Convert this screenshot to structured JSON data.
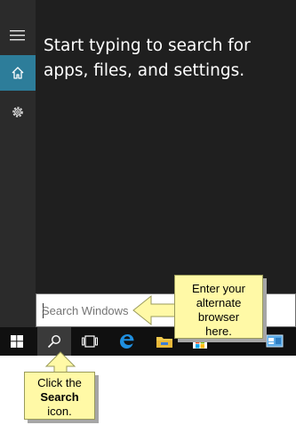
{
  "start_panel": {
    "prompt": "Start typing to search for apps, files, and settings."
  },
  "sidebar": {
    "items": [
      {
        "name": "menu",
        "icon": "hamburger-menu-icon"
      },
      {
        "name": "home",
        "icon": "home-icon",
        "active": true
      },
      {
        "name": "settings",
        "icon": "gear-icon"
      }
    ]
  },
  "search": {
    "placeholder": "Search Windows"
  },
  "taskbar": {
    "items": [
      "windows-start-icon",
      "search-icon",
      "task-view-icon",
      "edge-icon",
      "file-explorer-icon",
      "store-icon",
      "control-panel-icon"
    ]
  },
  "callouts": {
    "browser": {
      "lines": [
        "Enter your",
        "alternate",
        "browser",
        "here."
      ]
    },
    "search": {
      "line1": "Click the",
      "line2_bold": "Search",
      "line3": "icon."
    }
  },
  "colors": {
    "panel_bg": "#1f1f1f",
    "rail_bg": "#2b2b2b",
    "accent": "#2d7d9a",
    "callout_bg": "#fff9a6",
    "taskbar_bg": "#101010"
  }
}
